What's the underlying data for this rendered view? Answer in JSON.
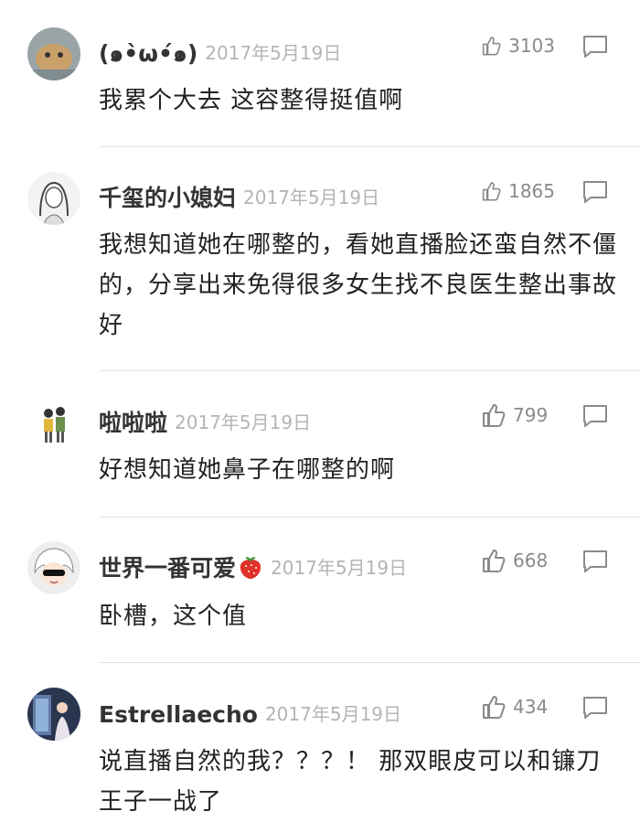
{
  "comments": [
    {
      "name": "(๑•̀ω•́๑)",
      "date": "2017年5月19日",
      "likes": "3103",
      "text": "我累个大去 这容整得挺值啊"
    },
    {
      "name": "千玺的小媳妇",
      "date": "2017年5月19日",
      "likes": "1865",
      "text": "我想知道她在哪整的，看她直播脸还蛮自然不僵的，分享出来免得很多女生找不良医生整出事故好"
    },
    {
      "name": "啦啦啦",
      "date": "2017年5月19日",
      "likes": "799",
      "text": "好想知道她鼻子在哪整的啊"
    },
    {
      "name": "世界一番可爱",
      "date": "2017年5月19日",
      "likes": "668",
      "text": "卧槽，这个值"
    },
    {
      "name": "Estrellaecho",
      "date": "2017年5月19日",
      "likes": "434",
      "text": "说直播自然的我？？？！ 那双眼皮可以和镰刀王子一战了"
    }
  ],
  "icons": {
    "like": "thumbs-up-icon",
    "reply": "comment-bubble-icon"
  },
  "colors": {
    "text": "#222222",
    "meta": "#b4b4b4",
    "icon": "#8a8a8a",
    "divider": "#e3e3e3"
  }
}
